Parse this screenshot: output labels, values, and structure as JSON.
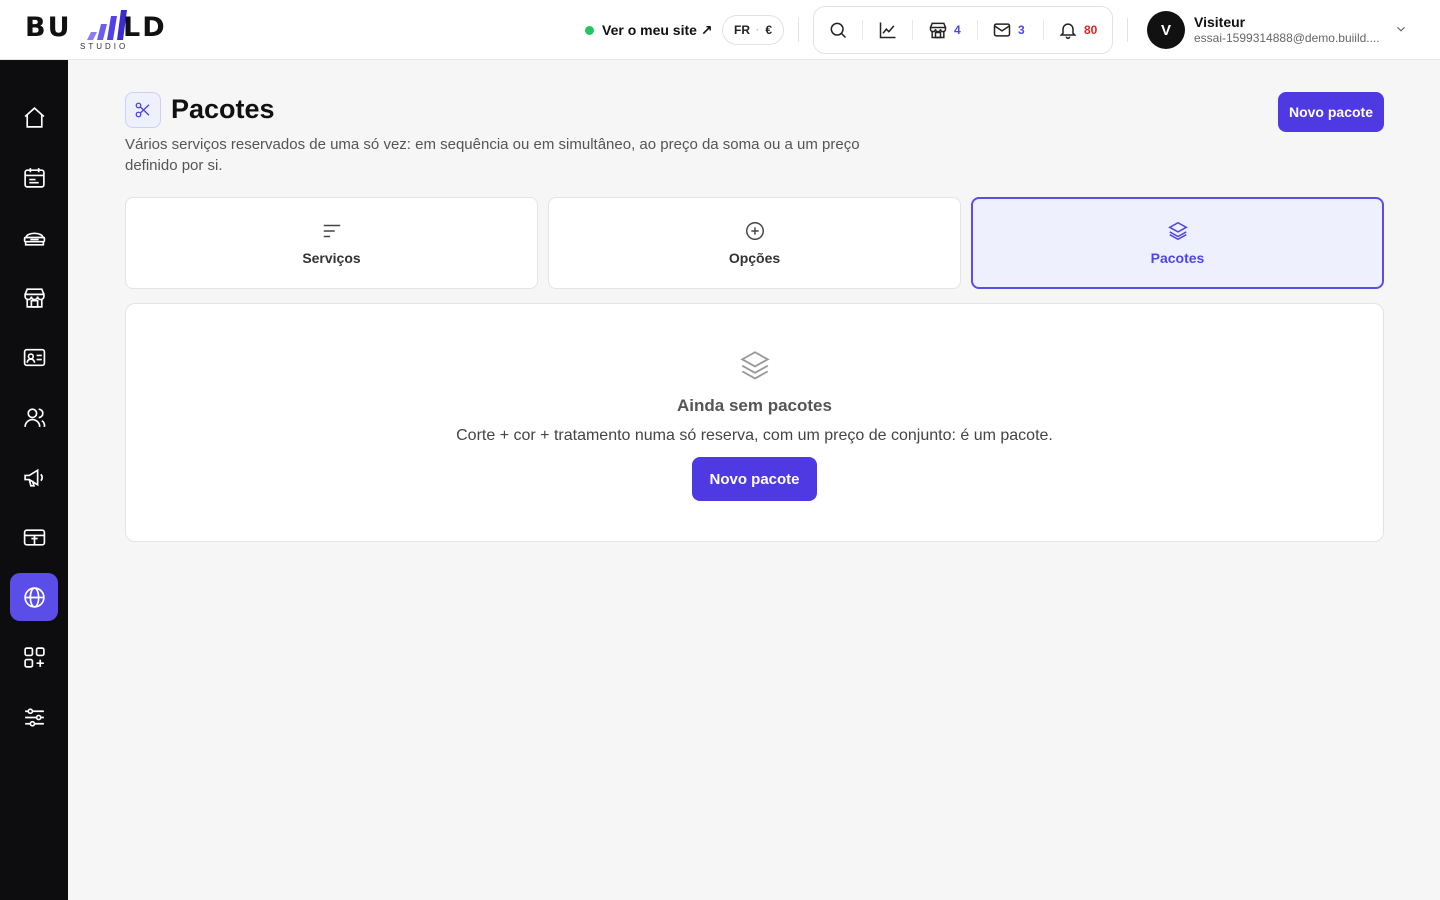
{
  "brand": {
    "logo_text_left": "BU",
    "logo_text_right": "LD",
    "logo_sub": "STUDIO"
  },
  "header": {
    "site_link": "Ver o meu site ↗",
    "locale": {
      "lang": "FR",
      "separator": "·",
      "currency": "€"
    },
    "tools": {
      "search_icon": "search-icon",
      "stats_icon": "chart-line-icon",
      "store_count": "4",
      "messages_count": "3",
      "notifications_count": "80"
    },
    "user": {
      "avatar_initial": "V",
      "name": "Visiteur",
      "email": "essai-1599314888@demo.buiild...."
    }
  },
  "sidebar": {
    "items": [
      {
        "icon": "home-icon"
      },
      {
        "icon": "calendar-icon"
      },
      {
        "icon": "services-icon"
      },
      {
        "icon": "store-icon"
      },
      {
        "icon": "contact-card-icon"
      },
      {
        "icon": "users-icon"
      },
      {
        "icon": "megaphone-icon"
      },
      {
        "icon": "payment-icon"
      },
      {
        "icon": "globe-icon",
        "active": true
      },
      {
        "icon": "apps-add-icon"
      },
      {
        "icon": "settings-sliders-icon"
      }
    ]
  },
  "page": {
    "title": "Pacotes",
    "description": "Vários serviços reservados de uma só vez: em sequência ou em simultâneo, ao preço da soma ou a um preço definido por si.",
    "new_button": "Novo pacote"
  },
  "tabs": [
    {
      "label": "Serviços",
      "icon": "list-lines-icon"
    },
    {
      "label": "Opções",
      "icon": "plus-circle-icon"
    },
    {
      "label": "Pacotes",
      "icon": "layers-icon",
      "active": true
    }
  ],
  "empty_state": {
    "title": "Ainda sem pacotes",
    "text": "Corte + cor + tratamento numa só reserva, com um preço de conjunto: é um pacote.",
    "button": "Novo pacote"
  },
  "colors": {
    "accent": "#4f39e3",
    "sidebar_bg": "#0d0d0f",
    "live": "#22c55e",
    "notification": "#dc2626"
  }
}
